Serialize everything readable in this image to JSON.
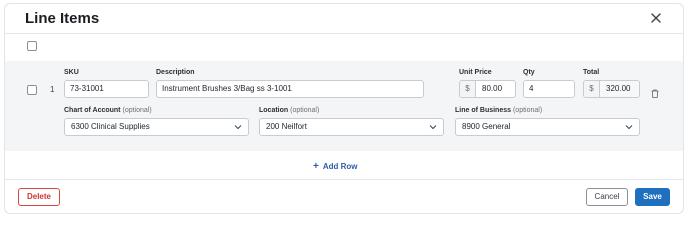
{
  "modal": {
    "title": "Line Items"
  },
  "line_item": {
    "row_number": "1",
    "sku": {
      "label": "SKU",
      "value": "73-31001"
    },
    "description": {
      "label": "Description",
      "value": "Instrument Brushes 3/Bag ss 3-1001"
    },
    "unit_price": {
      "label": "Unit Price",
      "currency_symbol": "$",
      "value": "80.00"
    },
    "qty": {
      "label": "Qty",
      "value": "4"
    },
    "total": {
      "label": "Total",
      "currency_symbol": "$",
      "value": "320.00"
    },
    "chart_of_account": {
      "label": "Chart of Account",
      "optional": "(optional)",
      "value": "6300 Clinical Supplies"
    },
    "location": {
      "label": "Location",
      "optional": "(optional)",
      "value": "200 Neilfort"
    },
    "line_of_business": {
      "label": "Line of Business",
      "optional": "(optional)",
      "value": "8900 General"
    }
  },
  "actions": {
    "add_row": "Add Row",
    "delete": "Delete",
    "cancel": "Cancel",
    "save": "Save"
  },
  "colors": {
    "primary": "#1f6fbf",
    "danger": "#c8392f",
    "panel_bg": "#f4f5f7"
  }
}
